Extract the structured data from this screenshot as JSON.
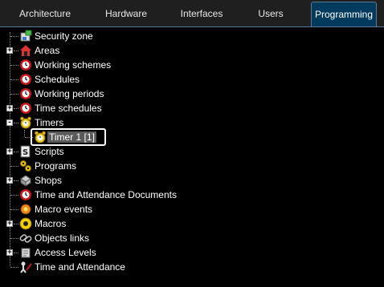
{
  "tabs": [
    {
      "label": "Architecture",
      "active": false
    },
    {
      "label": "Hardware",
      "active": false
    },
    {
      "label": "Interfaces",
      "active": false
    },
    {
      "label": "Users",
      "active": false
    },
    {
      "label": "Programming",
      "active": true
    }
  ],
  "tree": {
    "items": [
      {
        "label": "Security zone",
        "icon": "security-zone-icon",
        "expander": false
      },
      {
        "label": "Areas",
        "icon": "area-house-icon",
        "expander": "+"
      },
      {
        "label": "Working schemes",
        "icon": "red-clock-icon",
        "expander": false
      },
      {
        "label": "Schedules",
        "icon": "red-clock-icon",
        "expander": false
      },
      {
        "label": "Working periods",
        "icon": "red-clock-icon",
        "expander": false
      },
      {
        "label": "Time schedules",
        "icon": "red-clock-icon",
        "expander": "+"
      },
      {
        "label": "Timers",
        "icon": "alarm-clock-icon",
        "expander": "-"
      },
      {
        "label": "Timer 1 [1]",
        "icon": "alarm-clock-icon",
        "expander": false,
        "child": true,
        "selected": true
      },
      {
        "label": "Scripts",
        "icon": "script-icon",
        "expander": "+"
      },
      {
        "label": "Programs",
        "icon": "program-icon",
        "expander": false
      },
      {
        "label": "Shops",
        "icon": "shop-icon",
        "expander": "+"
      },
      {
        "label": "Time and Attendance Documents",
        "icon": "red-clock-icon",
        "expander": false
      },
      {
        "label": "Macro events",
        "icon": "macro-event-icon",
        "expander": false
      },
      {
        "label": "Macros",
        "icon": "macro-icon",
        "expander": "+"
      },
      {
        "label": "Objects links",
        "icon": "link-icon",
        "expander": false
      },
      {
        "label": "Access Levels",
        "icon": "access-level-icon",
        "expander": "+"
      },
      {
        "label": "Time and Attendance",
        "icon": "attendance-icon",
        "expander": false
      }
    ]
  },
  "colors": {
    "active_tab": "#003a5c",
    "selection": "#5a5a5a",
    "clock_red": "#c41616"
  }
}
